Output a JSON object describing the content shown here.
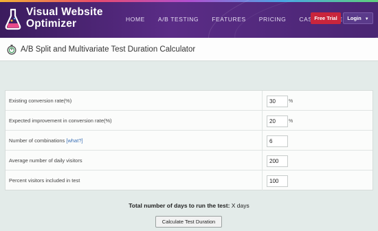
{
  "header": {
    "logo_line1": "Visual Website",
    "logo_line2": "Optimizer",
    "nav": [
      "HOME",
      "A/B TESTING",
      "FEATURES",
      "PRICING",
      "CASE STUDIES"
    ],
    "free_trial_label": "Free Trial",
    "login_label": "Login",
    "colors": {
      "header_bg": "#4a2673",
      "trial_bg": "#c9253c",
      "login_bg": "#5a3a8a"
    }
  },
  "page": {
    "title": "A/B Split and Multivariate Test Duration Calculator",
    "icon": "stopwatch-icon"
  },
  "form": {
    "rows": [
      {
        "label": "Existing conversion rate(%)",
        "value": "30",
        "unit": "%"
      },
      {
        "label": "Expected improvement in conversion rate(%)",
        "value": "20",
        "unit": "%"
      },
      {
        "label": "Number of combinations",
        "help": "[what?]",
        "value": "6"
      },
      {
        "label": "Average number of daily visitors",
        "value": "200"
      },
      {
        "label": "Percent visitors included in test",
        "value": "100"
      }
    ]
  },
  "result": {
    "label": "Total number of days to run the test:",
    "value": "X days"
  },
  "button": {
    "label": "Calculate Test Duration"
  }
}
